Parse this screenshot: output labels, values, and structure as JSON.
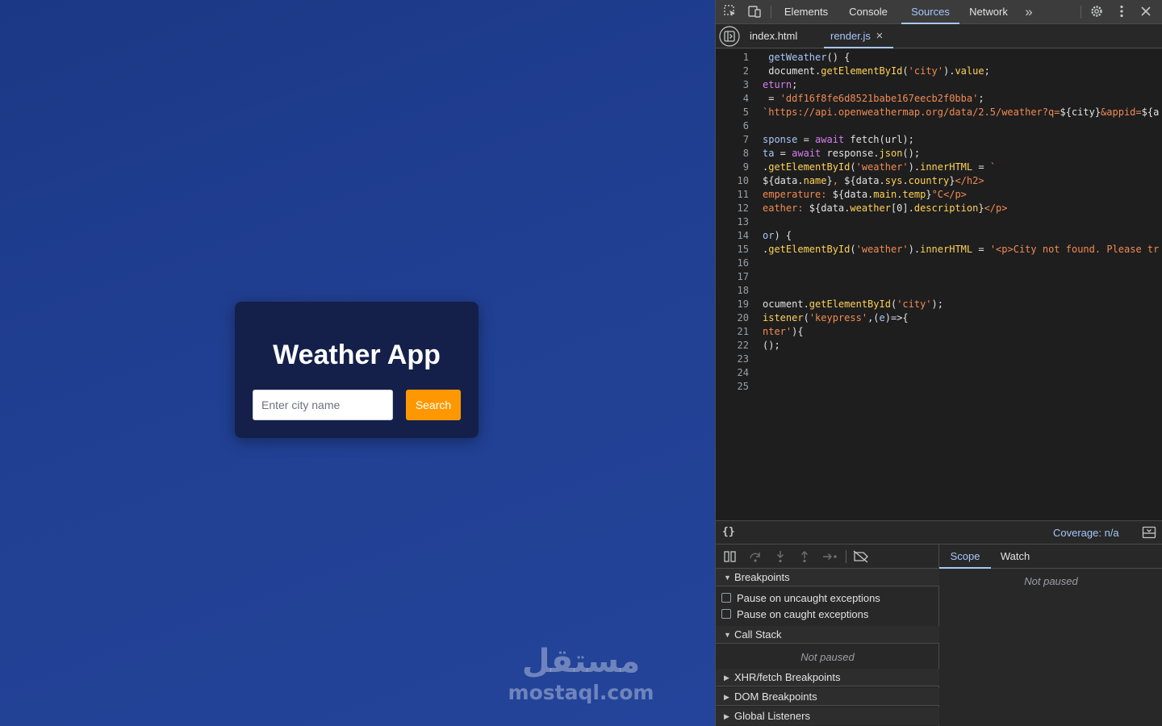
{
  "app": {
    "title": "Weather App",
    "city_placeholder": "Enter city name",
    "search_label": "Search",
    "watermark_logo": "مستقل",
    "watermark_text": "mostaql.com"
  },
  "devtools": {
    "tabs": [
      {
        "label": "Elements",
        "active": false
      },
      {
        "label": "Console",
        "active": false
      },
      {
        "label": "Sources",
        "active": true
      },
      {
        "label": "Network",
        "active": false
      }
    ],
    "more_tabs_icon": "chevron-double-right-icon",
    "file_tabs": [
      {
        "label": "index.html",
        "active": false
      },
      {
        "label": "render.js",
        "active": true
      }
    ],
    "close_glyph": "×",
    "code_lines": [
      {
        "n": "1",
        "parts": [
          [
            " getWeather",
            "#a8c7fa"
          ],
          [
            "() {",
            "#e3e3e3"
          ]
        ]
      },
      {
        "n": "2",
        "parts": [
          [
            " document.",
            "#e3e3e3"
          ],
          [
            "getElementById",
            "#ffd257"
          ],
          [
            "(",
            "#e3e3e3"
          ],
          [
            "'city'",
            "#f28b54"
          ],
          [
            ").",
            "#e3e3e3"
          ],
          [
            "value",
            "#ffd257"
          ],
          [
            ";",
            "#e3e3e3"
          ]
        ]
      },
      {
        "n": "3",
        "parts": [
          [
            "eturn",
            "#d67ef0"
          ],
          [
            ";",
            "#e3e3e3"
          ]
        ]
      },
      {
        "n": "4",
        "parts": [
          [
            " = ",
            "#e3e3e3"
          ],
          [
            "'ddf16f8fe6d8521babe167eecb2f0bba'",
            "#f28b54"
          ],
          [
            ";",
            "#e3e3e3"
          ]
        ]
      },
      {
        "n": "5",
        "parts": [
          [
            "`https://api.openweathermap.org/data/2.5/weather?q=",
            "#f28b54"
          ],
          [
            "${city}",
            "#e3e3e3"
          ],
          [
            "&appid=",
            "#f28b54"
          ],
          [
            "${a",
            "#e3e3e3"
          ]
        ]
      },
      {
        "n": "6",
        "parts": []
      },
      {
        "n": "7",
        "parts": [
          [
            "sponse",
            "#a8c7fa"
          ],
          [
            " = ",
            "#e3e3e3"
          ],
          [
            "await",
            "#d67ef0"
          ],
          [
            " fetch(url);",
            "#e3e3e3"
          ]
        ]
      },
      {
        "n": "8",
        "parts": [
          [
            "ta",
            "#a8c7fa"
          ],
          [
            " = ",
            "#e3e3e3"
          ],
          [
            "await",
            "#d67ef0"
          ],
          [
            " response.",
            "#e3e3e3"
          ],
          [
            "json",
            "#ffd257"
          ],
          [
            "();",
            "#e3e3e3"
          ]
        ]
      },
      {
        "n": "9",
        "parts": [
          [
            ".",
            "#e3e3e3"
          ],
          [
            "getElementById",
            "#ffd257"
          ],
          [
            "(",
            "#e3e3e3"
          ],
          [
            "'weather'",
            "#f28b54"
          ],
          [
            ").",
            "#e3e3e3"
          ],
          [
            "innerHTML",
            "#ffd257"
          ],
          [
            " = ",
            "#e3e3e3"
          ],
          [
            "`",
            "#f28b54"
          ]
        ]
      },
      {
        "n": "10",
        "parts": [
          [
            "${data.",
            "#e3e3e3"
          ],
          [
            "name",
            "#ffd257"
          ],
          [
            "}",
            "#e3e3e3"
          ],
          [
            ", ",
            "#f28b54"
          ],
          [
            "${data.",
            "#e3e3e3"
          ],
          [
            "sys",
            "#ffd257"
          ],
          [
            ".",
            "#e3e3e3"
          ],
          [
            "country",
            "#ffd257"
          ],
          [
            "}",
            "#e3e3e3"
          ],
          [
            "</h2>",
            "#f28b54"
          ]
        ]
      },
      {
        "n": "11",
        "parts": [
          [
            "emperature: ",
            "#f28b54"
          ],
          [
            "${data.",
            "#e3e3e3"
          ],
          [
            "main",
            "#ffd257"
          ],
          [
            ".",
            "#e3e3e3"
          ],
          [
            "temp",
            "#ffd257"
          ],
          [
            "}",
            "#e3e3e3"
          ],
          [
            "°C</p>",
            "#f28b54"
          ]
        ]
      },
      {
        "n": "12",
        "parts": [
          [
            "eather: ",
            "#f28b54"
          ],
          [
            "${data.",
            "#e3e3e3"
          ],
          [
            "weather",
            "#ffd257"
          ],
          [
            "[0].",
            "#e3e3e3"
          ],
          [
            "description",
            "#ffd257"
          ],
          [
            "}",
            "#e3e3e3"
          ],
          [
            "</p>",
            "#f28b54"
          ]
        ]
      },
      {
        "n": "13",
        "parts": []
      },
      {
        "n": "14",
        "parts": [
          [
            "or",
            "#a8c7fa"
          ],
          [
            ") {",
            "#e3e3e3"
          ]
        ]
      },
      {
        "n": "15",
        "parts": [
          [
            ".",
            "#e3e3e3"
          ],
          [
            "getElementById",
            "#ffd257"
          ],
          [
            "(",
            "#e3e3e3"
          ],
          [
            "'weather'",
            "#f28b54"
          ],
          [
            ").",
            "#e3e3e3"
          ],
          [
            "innerHTML",
            "#ffd257"
          ],
          [
            " = ",
            "#e3e3e3"
          ],
          [
            "'<p>City not found. Please tr",
            "#f28b54"
          ]
        ]
      },
      {
        "n": "16",
        "parts": []
      },
      {
        "n": "17",
        "parts": []
      },
      {
        "n": "18",
        "parts": []
      },
      {
        "n": "19",
        "parts": [
          [
            "ocument.",
            "#e3e3e3"
          ],
          [
            "getElementById",
            "#ffd257"
          ],
          [
            "(",
            "#e3e3e3"
          ],
          [
            "'city'",
            "#f28b54"
          ],
          [
            ");",
            "#e3e3e3"
          ]
        ]
      },
      {
        "n": "20",
        "parts": [
          [
            "istener",
            "#ffd257"
          ],
          [
            "(",
            "#e3e3e3"
          ],
          [
            "'keypress'",
            "#f28b54"
          ],
          [
            ",(",
            "#e3e3e3"
          ],
          [
            "e",
            "#a8c7fa"
          ],
          [
            ")=>{",
            "#e3e3e3"
          ]
        ]
      },
      {
        "n": "21",
        "parts": [
          [
            "nter'",
            "#f28b54"
          ],
          [
            "){",
            "#e3e3e3"
          ]
        ]
      },
      {
        "n": "22",
        "parts": [
          [
            "();",
            "#e3e3e3"
          ]
        ]
      },
      {
        "n": "23",
        "parts": []
      },
      {
        "n": "24",
        "parts": []
      },
      {
        "n": "25",
        "parts": []
      }
    ],
    "format_glyph": "{}",
    "coverage": "Coverage: n/a",
    "sections": {
      "breakpoints": "Breakpoints",
      "pause_uncaught": "Pause on uncaught exceptions",
      "pause_caught": "Pause on caught exceptions",
      "call_stack": "Call Stack",
      "not_paused": "Not paused",
      "xhr": "XHR/fetch Breakpoints",
      "dom": "DOM Breakpoints",
      "global": "Global Listeners"
    },
    "scope_tabs": [
      {
        "label": "Scope",
        "active": true
      },
      {
        "label": "Watch",
        "active": false
      }
    ],
    "scope_not_paused": "Not paused"
  },
  "colors": {
    "accent_blue": "#a8c7fa",
    "search_orange": "#ff9800",
    "card_bg": "#14204a"
  }
}
